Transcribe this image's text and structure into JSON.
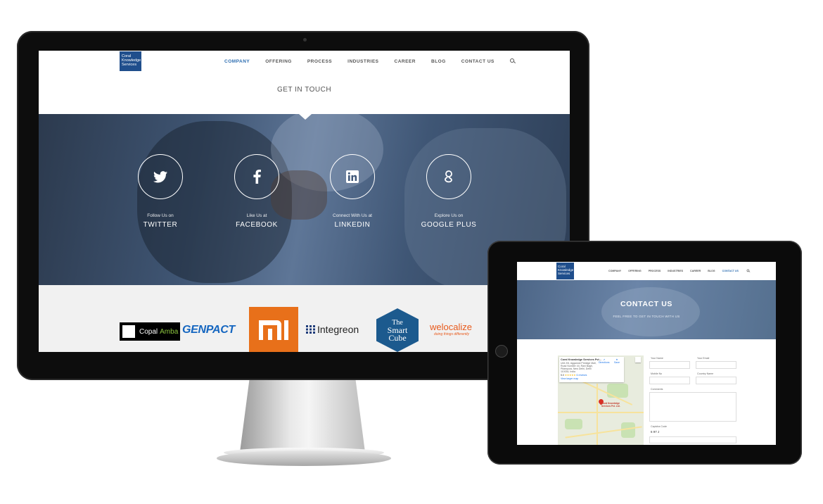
{
  "desktop": {
    "logo": "Coral Knowledge Services",
    "nav": {
      "items": [
        "COMPANY",
        "OFFERING",
        "PROCESS",
        "INDUSTRIES",
        "CAREER",
        "BLOG",
        "CONTACT US"
      ],
      "active": "COMPANY",
      "search_icon": "search-icon"
    },
    "get_in_touch": {
      "title": "GET IN TOUCH"
    },
    "social": [
      {
        "pre": "Follow Us on",
        "network": "TWITTER",
        "icon": "twitter-icon"
      },
      {
        "pre": "Like Us at",
        "network": "FACEBOOK",
        "icon": "facebook-icon"
      },
      {
        "pre": "Connect With Us at",
        "network": "LINKEDIN",
        "icon": "linkedin-icon"
      },
      {
        "pre": "Explore Us on",
        "network": "GOOGLE PLUS",
        "icon": "google-plus-icon"
      }
    ],
    "client_logos": {
      "copal_amba": {
        "part1": "Copal",
        "part2": "Amba"
      },
      "genpact": "GENPACT",
      "mi": "mi",
      "integreon": "Integreon",
      "smart_cube": {
        "line1": "The",
        "line2": "Smart",
        "line3": "Cube"
      },
      "welocalize": {
        "name": "welocalize",
        "tagline": "doing things differently"
      }
    }
  },
  "tablet": {
    "logo": "Coral Knowledge Services",
    "nav": {
      "items": [
        "COMPANY",
        "OFFERING",
        "PROCESS",
        "INDUSTRIES",
        "CAREER",
        "BLOG",
        "CONTACT US"
      ],
      "active": "CONTACT US"
    },
    "hero": {
      "title": "CONTACT US",
      "subtitle": "FEEL FREE TO GET IN TOUCH WITH US"
    },
    "map_card": {
      "name": "Coral Knowledge Services Pvt...",
      "address": "Unit 2/6, Aggarwal Prestige Mall, Road Number 44, Rani Bagh, Pitampura, New Delhi, Delhi 110034, India",
      "rating": "5.0",
      "reviews": "6 reviews",
      "link": "View larger map",
      "directions": "Directions",
      "save": "Save",
      "pin_label": "Coral Knowledge Services Pvt. Ltd."
    },
    "form": {
      "your_name": "Your Name",
      "your_email": "Your Email",
      "mobile_no": "Mobile No",
      "country_name": "Country Name",
      "comments": "Comments",
      "captcha_label": "Captcha Code",
      "captcha_value": "6 97 J"
    }
  },
  "colors": {
    "brand_blue": "#1f4e8c",
    "active_nav": "#2b6cb0",
    "mi_orange": "#e8701a",
    "smart_cube_blue": "#1c5a8e",
    "genpact_blue": "#1566c0",
    "welocalize_orange": "#e85a1c"
  }
}
